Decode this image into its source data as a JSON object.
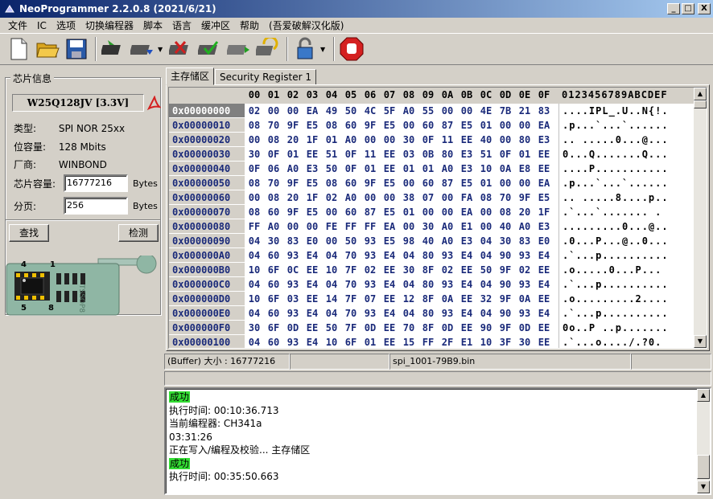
{
  "window": {
    "title": "NeoProgrammer 2.2.0.8 (2021/6/21)",
    "min_label": "_",
    "max_label": "□",
    "close_label": "X"
  },
  "menu": [
    "文件",
    "IC",
    "选项",
    "切换编程器",
    "脚本",
    "语言",
    "缓冲区",
    "帮助",
    "(吾爱破解汉化版)"
  ],
  "toolbar": {
    "buttons": [
      "new-file-icon",
      "open-folder-icon",
      "save-icon",
      "chip-read-icon",
      "chip-write-icon",
      "chip-erase-icon",
      "chip-verify-icon",
      "chip-blank-check-icon",
      "auto-program-icon",
      "lock-icon",
      "stop-icon"
    ]
  },
  "chip_info": {
    "group_title": "芯片信息",
    "chip_name": "W25Q128JV [3.3V]",
    "type_label": "类型:",
    "type_value": "SPI NOR 25xx",
    "capacity_label": "位容量:",
    "capacity_value": "128 Mbits",
    "vendor_label": "厂商:",
    "vendor_value": "WINBOND",
    "size_label": "芯片容量:",
    "size_value": "16777216",
    "size_unit": "Bytes",
    "page_label": "分页:",
    "page_value": "256",
    "page_unit": "Bytes",
    "find_button": "查找",
    "detect_button": "检测"
  },
  "adapter": {
    "pin1": "1",
    "pin4": "4",
    "pin5": "5",
    "pin8": "8",
    "brand": "TSSOP8"
  },
  "tabs": [
    "主存储区",
    "Security Register 1"
  ],
  "hex": {
    "columns": [
      "00",
      "01",
      "02",
      "03",
      "04",
      "05",
      "06",
      "07",
      "08",
      "09",
      "0A",
      "0B",
      "0C",
      "0D",
      "0E",
      "0F"
    ],
    "ascii_header": "0123456789ABCDEF",
    "rows": [
      {
        "addr": "0x00000000",
        "bytes": [
          "02",
          "00",
          "00",
          "EA",
          "49",
          "50",
          "4C",
          "5F",
          "A0",
          "55",
          "00",
          "00",
          "4E",
          "7B",
          "21",
          "83"
        ],
        "ascii": "....IPL_.U..N{!."
      },
      {
        "addr": "0x00000010",
        "bytes": [
          "08",
          "70",
          "9F",
          "E5",
          "08",
          "60",
          "9F",
          "E5",
          "00",
          "60",
          "87",
          "E5",
          "01",
          "00",
          "00",
          "EA"
        ],
        "ascii": ".p...`...`......"
      },
      {
        "addr": "0x00000020",
        "bytes": [
          "00",
          "08",
          "20",
          "1F",
          "01",
          "A0",
          "00",
          "00",
          "30",
          "0F",
          "11",
          "EE",
          "40",
          "00",
          "80",
          "E3"
        ],
        "ascii": ".. .....0...@..."
      },
      {
        "addr": "0x00000030",
        "bytes": [
          "30",
          "0F",
          "01",
          "EE",
          "51",
          "0F",
          "11",
          "EE",
          "03",
          "0B",
          "80",
          "E3",
          "51",
          "0F",
          "01",
          "EE"
        ],
        "ascii": "0...Q.......Q..."
      },
      {
        "addr": "0x00000040",
        "bytes": [
          "0F",
          "06",
          "A0",
          "E3",
          "50",
          "0F",
          "01",
          "EE",
          "01",
          "01",
          "A0",
          "E3",
          "10",
          "0A",
          "E8",
          "EE"
        ],
        "ascii": "....P..........."
      },
      {
        "addr": "0x00000050",
        "bytes": [
          "08",
          "70",
          "9F",
          "E5",
          "08",
          "60",
          "9F",
          "E5",
          "00",
          "60",
          "87",
          "E5",
          "01",
          "00",
          "00",
          "EA"
        ],
        "ascii": ".p...`...`......"
      },
      {
        "addr": "0x00000060",
        "bytes": [
          "00",
          "08",
          "20",
          "1F",
          "02",
          "A0",
          "00",
          "00",
          "38",
          "07",
          "00",
          "FA",
          "08",
          "70",
          "9F",
          "E5"
        ],
        "ascii": ".. .....8....p.."
      },
      {
        "addr": "0x00000070",
        "bytes": [
          "08",
          "60",
          "9F",
          "E5",
          "00",
          "60",
          "87",
          "E5",
          "01",
          "00",
          "00",
          "EA",
          "00",
          "08",
          "20",
          "1F"
        ],
        "ascii": ".`...`....... ."
      },
      {
        "addr": "0x00000080",
        "bytes": [
          "FF",
          "A0",
          "00",
          "00",
          "FE",
          "FF",
          "FF",
          "EA",
          "00",
          "30",
          "A0",
          "E1",
          "00",
          "40",
          "A0",
          "E3"
        ],
        "ascii": ".........0...@.."
      },
      {
        "addr": "0x00000090",
        "bytes": [
          "04",
          "30",
          "83",
          "E0",
          "00",
          "50",
          "93",
          "E5",
          "98",
          "40",
          "A0",
          "E3",
          "04",
          "30",
          "83",
          "E0"
        ],
        "ascii": ".0...P...@..0..."
      },
      {
        "addr": "0x000000A0",
        "bytes": [
          "04",
          "60",
          "93",
          "E4",
          "04",
          "70",
          "93",
          "E4",
          "04",
          "80",
          "93",
          "E4",
          "04",
          "90",
          "93",
          "E4"
        ],
        "ascii": ".`...p.........."
      },
      {
        "addr": "0x000000B0",
        "bytes": [
          "10",
          "6F",
          "0C",
          "EE",
          "10",
          "7F",
          "02",
          "EE",
          "30",
          "8F",
          "02",
          "EE",
          "50",
          "9F",
          "02",
          "EE"
        ],
        "ascii": ".o.....0...P..."
      },
      {
        "addr": "0x000000C0",
        "bytes": [
          "04",
          "60",
          "93",
          "E4",
          "04",
          "70",
          "93",
          "E4",
          "04",
          "80",
          "93",
          "E4",
          "04",
          "90",
          "93",
          "E4"
        ],
        "ascii": ".`...p.........."
      },
      {
        "addr": "0x000000D0",
        "bytes": [
          "10",
          "6F",
          "03",
          "EE",
          "14",
          "7F",
          "07",
          "EE",
          "12",
          "8F",
          "0A",
          "EE",
          "32",
          "9F",
          "0A",
          "EE"
        ],
        "ascii": ".o.........2...."
      },
      {
        "addr": "0x000000E0",
        "bytes": [
          "04",
          "60",
          "93",
          "E4",
          "04",
          "70",
          "93",
          "E4",
          "04",
          "80",
          "93",
          "E4",
          "04",
          "90",
          "93",
          "E4"
        ],
        "ascii": ".`...p.........."
      },
      {
        "addr": "0x000000F0",
        "bytes": [
          "30",
          "6F",
          "0D",
          "EE",
          "50",
          "7F",
          "0D",
          "EE",
          "70",
          "8F",
          "0D",
          "EE",
          "90",
          "9F",
          "0D",
          "EE"
        ],
        "ascii": "0o..P ..p......."
      },
      {
        "addr": "0x00000100",
        "bytes": [
          "04",
          "60",
          "93",
          "E4",
          "10",
          "6F",
          "01",
          "EE",
          "15",
          "FF",
          "2F",
          "E1",
          "10",
          "3F",
          "30",
          "EE"
        ],
        "ascii": ".`...o..../.?0."
      }
    ]
  },
  "status": {
    "buffer_size": "(Buffer) 大小 : 16777216",
    "filename": "spi_1001-79B9.bin"
  },
  "log": [
    {
      "text": "成功",
      "ok": true
    },
    {
      "text": "执行时间:  00:10:36.713",
      "ok": false
    },
    {
      "text": "当前编程器: CH341a",
      "ok": false
    },
    {
      "text": "03:31:26",
      "ok": false
    },
    {
      "text": "正在写入/编程及校验...  主存储区",
      "ok": false
    },
    {
      "text": "成功",
      "ok": true
    },
    {
      "text": "执行时间:  00:35:50.663",
      "ok": false
    }
  ]
}
